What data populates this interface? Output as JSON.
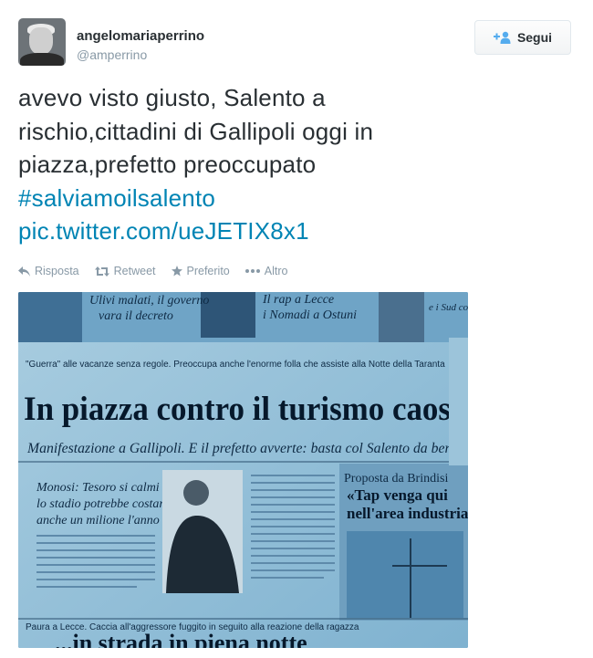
{
  "author": {
    "display_name": "angelomariaperrino",
    "handle": "@amperrino"
  },
  "follow_button": {
    "label": "Segui"
  },
  "tweet": {
    "line1": "avevo visto giusto, Salento a",
    "line2": "rischio,cittadini di Gallipoli oggi in",
    "line3": "piazza,prefetto preoccupato",
    "hashtag": "#salviamoilsalento",
    "pic_link": "pic.twitter.com/ueJETIX8x1"
  },
  "actions": {
    "reply": "Risposta",
    "retweet": "Retweet",
    "favorite": "Preferito",
    "more": "Altro"
  },
  "photo": {
    "top_headline_left_1": "Ulivi malati, il governo",
    "top_headline_left_2": "vara il decreto",
    "top_headline_mid_1": "Il rap a Lecce",
    "top_headline_mid_2": "i Nomadi a Ostuni",
    "top_headline_right": "e i Sud col nuo",
    "kicker": "\"Guerra\" alle vacanze senza regole. Preoccupa anche l'enorme folla che assiste alla Notte della Taranta",
    "main_headline": "In piazza contro il turismo caos",
    "subheadline": "Manifestazione a Gallipoli. E il prefetto avverte: basta col Salento da bere",
    "side_headline_1": "Monosi: Tesoro si calmi",
    "side_headline_2": "lo stadio potrebbe costargli",
    "side_headline_3": "anche un milione l'anno",
    "right_headline_1": "Proposta da Brindisi",
    "right_headline_2": "«Tap venga qui",
    "right_headline_3": "nell'area industriale»",
    "bottom_kicker": "Paura a Lecce. Caccia all'aggressore fuggito in seguito alla reazione della ragazza",
    "bottom_headline": "...in strada in piena notte"
  },
  "colors": {
    "link": "#0084b4",
    "text": "#292f33",
    "muted": "#8899a6"
  }
}
